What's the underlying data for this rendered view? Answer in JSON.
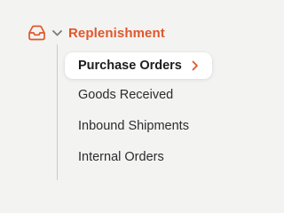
{
  "colors": {
    "accent": "#e0572a",
    "text": "#2c2c2e",
    "muted_icon": "#7b7b80"
  },
  "section": {
    "label": "Replenishment",
    "icon": "inbox-tray-icon",
    "expanded": true
  },
  "items": [
    {
      "label": "Purchase Orders",
      "active": true
    },
    {
      "label": "Goods Received",
      "active": false
    },
    {
      "label": "Inbound Shipments",
      "active": false
    },
    {
      "label": "Internal Orders",
      "active": false
    }
  ]
}
